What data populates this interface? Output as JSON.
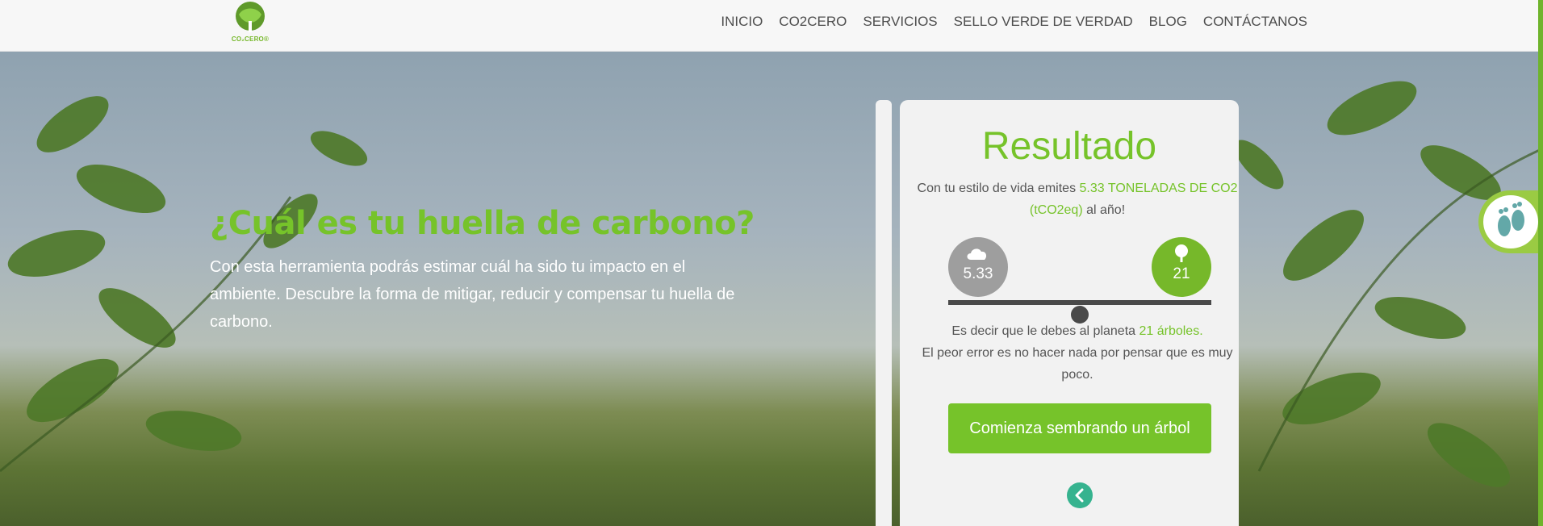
{
  "header": {
    "logo_text": "CO₂CERO®",
    "nav": [
      "INICIO",
      "CO2CERO",
      "SERVICIOS",
      "SELLO VERDE DE VERDAD",
      "BLOG",
      "CONTÁCTANOS"
    ]
  },
  "hero": {
    "title": "¿Cuál es tu huella de carbono?",
    "text": "Con esta herramienta podrás estimar cuál ha sido tu impacto en el ambiente. Descubre la forma de mitigar, reducir y compensar tu huella de carbono."
  },
  "result": {
    "title": "Resultado",
    "emits_prefix": "Con tu estilo de vida emites ",
    "emits_value": "5.33 TONELADAS DE CO2 (tCO2eq)",
    "emits_suffix": " al año!",
    "co2_value": "5.33",
    "trees_value": "21",
    "owe_prefix": "Es decir que le debes al planeta ",
    "owe_value": "21 árboles.",
    "warning": "El peor error es no hacer nada por pensar que es muy poco.",
    "cta": "Comienza sembrando un árbol"
  },
  "colors": {
    "brand_green": "#76c32a",
    "grey": "#9e9e9e",
    "teal": "#36b38f"
  },
  "icons": [
    "cloud-icon",
    "tree-icon",
    "chevron-left-icon",
    "footprint-icon",
    "logo-tree-icon"
  ]
}
